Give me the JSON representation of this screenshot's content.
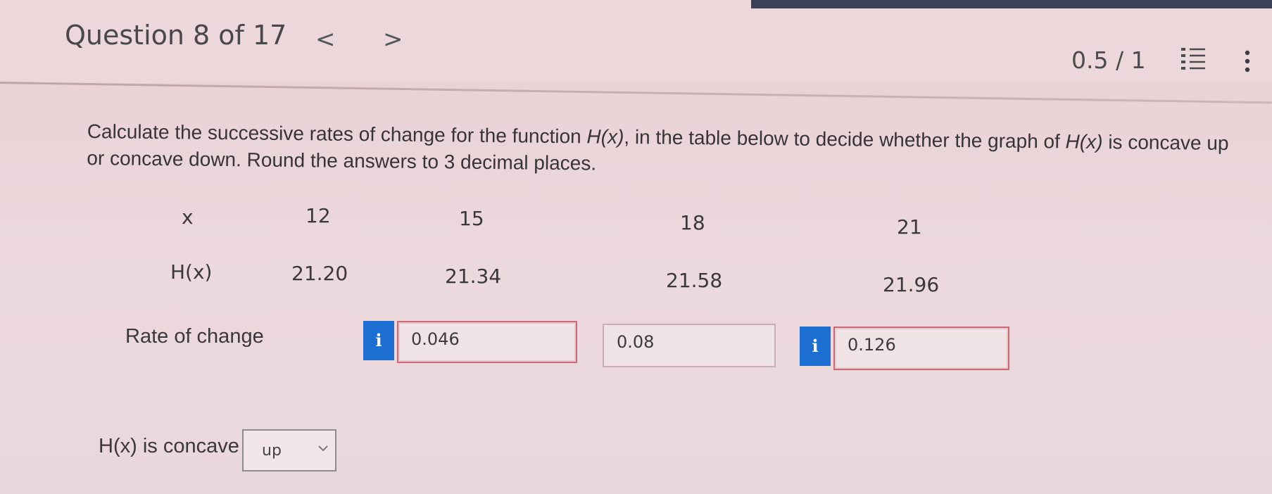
{
  "header": {
    "question_label": "Question 8 of 17",
    "prev_glyph": "<",
    "next_glyph": ">",
    "score": "0.5 / 1",
    "list_icon": "list-icon",
    "more_icon": "more-vertical-icon"
  },
  "prompt": {
    "part1": "Calculate the successive rates of change for the function ",
    "fn1": "H(x)",
    "part2": ", in the table below to decide whether the graph of ",
    "fn2": "H(x)",
    "part3": " is concave up or concave down. Round the answers to 3 decimal places."
  },
  "table": {
    "x_label": "x",
    "x_values": [
      "12",
      "15",
      "18",
      "21"
    ],
    "h_label": "H(x)",
    "h_values": [
      "21.20",
      "21.34",
      "21.58",
      "21.96"
    ]
  },
  "rates": {
    "label": "Rate of change",
    "info_glyph": "i",
    "answers": [
      "0.046",
      "0.08",
      "0.126"
    ]
  },
  "concavity": {
    "label": "H(x) is concave",
    "selected": "up"
  },
  "colors": {
    "info_blue": "#1c6fd0",
    "error_border": "#c96a78",
    "top_stripe": "#3b4156"
  }
}
